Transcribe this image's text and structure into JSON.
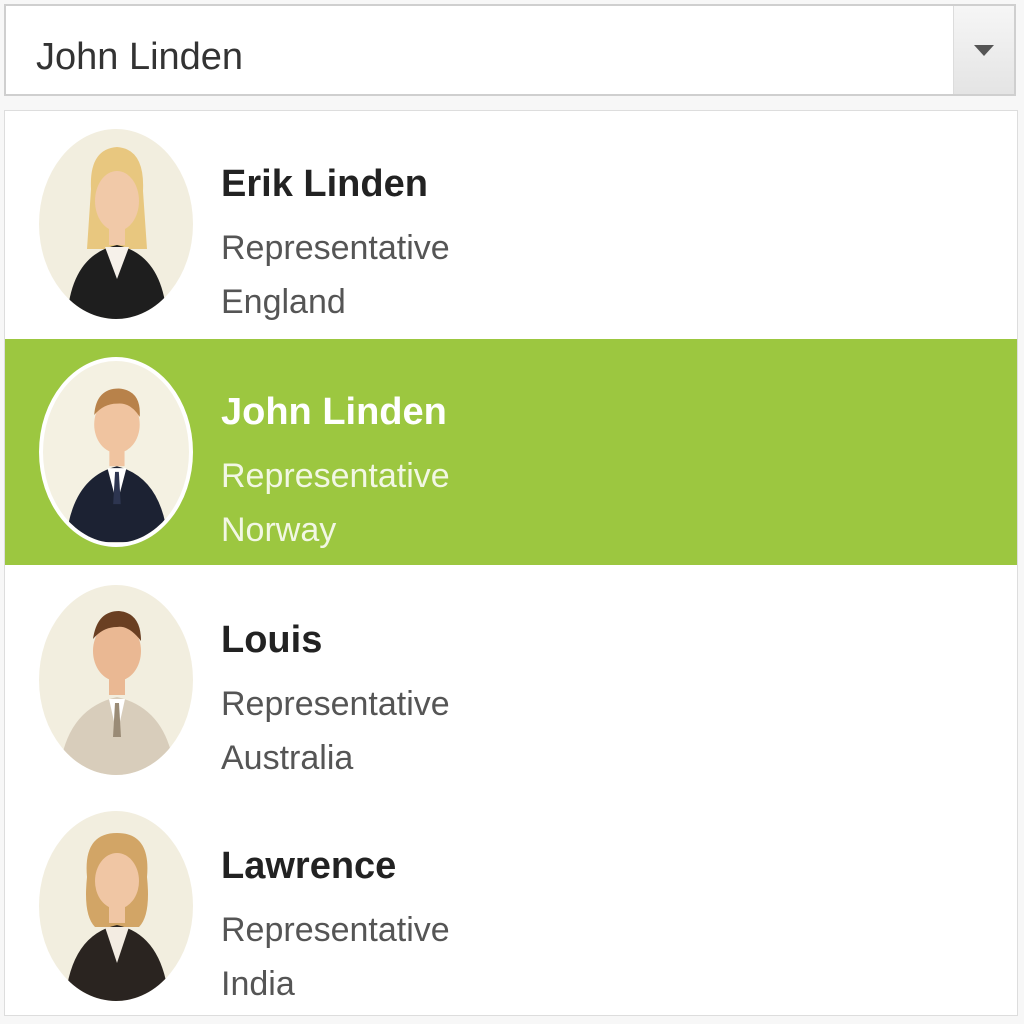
{
  "combobox": {
    "selected_value": "John Linden",
    "dropdown_icon": "triangle-down-icon"
  },
  "items": [
    {
      "name": "Erik Linden",
      "role": "Representative",
      "country": "England",
      "selected": false
    },
    {
      "name": "John Linden",
      "role": "Representative",
      "country": "Norway",
      "selected": true
    },
    {
      "name": "Louis",
      "role": "Representative",
      "country": "Australia",
      "selected": false
    },
    {
      "name": "Lawrence",
      "role": "Representative",
      "country": "India",
      "selected": false
    }
  ],
  "colors": {
    "selection": "#9cc740",
    "text_dark": "#222222",
    "text_muted": "#555555"
  }
}
